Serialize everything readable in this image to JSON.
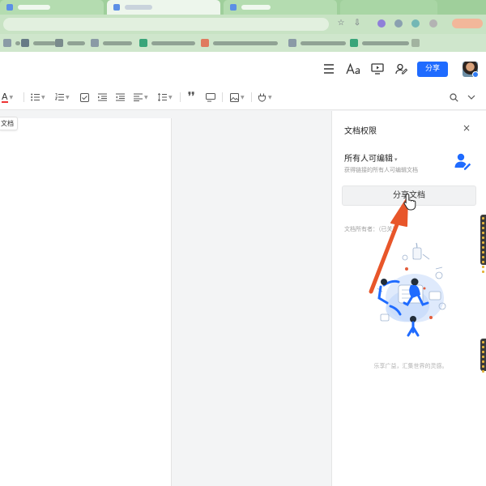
{
  "toolbar": {
    "font_color_glyph": "A"
  },
  "doc": {
    "tab_chip": "文档"
  },
  "header": {
    "share_label": "分享"
  },
  "panel": {
    "title": "文档权限",
    "close_glyph": "×",
    "permission_label": "所有人可编辑",
    "permission_caret": "▾",
    "permission_desc": "获得链接的所有人可编辑文档",
    "share_doc_button": "分享文档",
    "owner_label": "文档所有者：（已关）",
    "slogan": "乐享广益，汇集世界的灵感。"
  },
  "colors": {
    "accent": "#1f6bff",
    "arrow": "#e8562a",
    "browser_chrome": "#9fcf9b"
  },
  "icons": [
    "menu-icon",
    "font-style-icon",
    "present-icon",
    "collaborator-icon",
    "search-icon",
    "chevron-down-icon",
    "close-icon"
  ]
}
